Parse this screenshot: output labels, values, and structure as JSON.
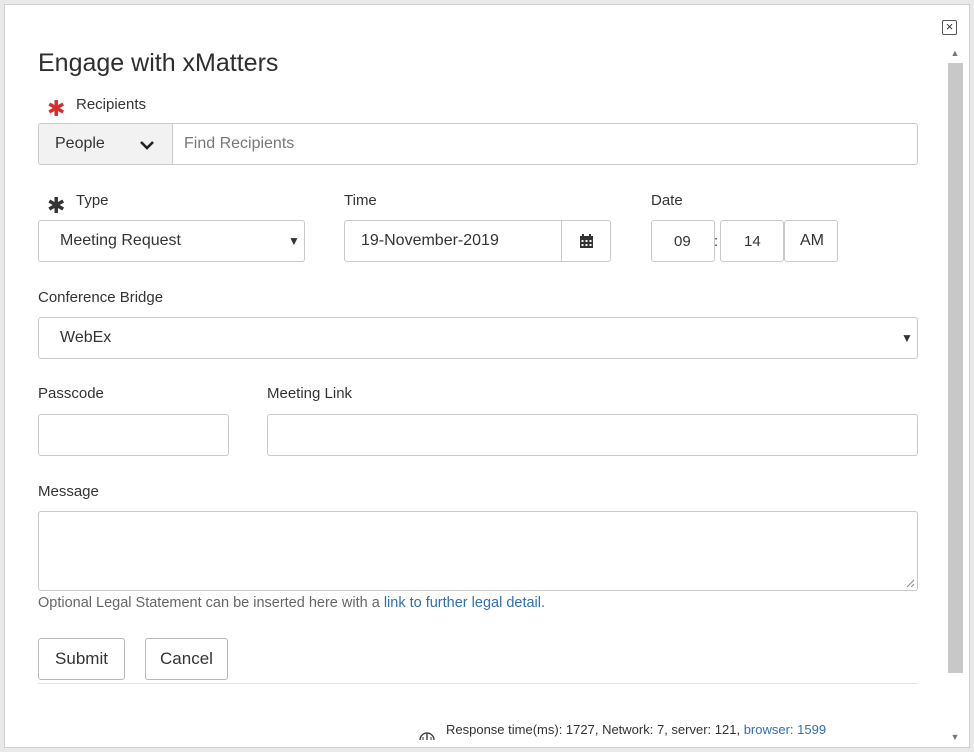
{
  "dialog": {
    "title": "Engage with xMatters",
    "close_icon": "close-icon"
  },
  "recipients": {
    "label": "Recipients",
    "type_selected": "People",
    "search_placeholder": "Find Recipients"
  },
  "type": {
    "label": "Type",
    "selected": "Meeting Request"
  },
  "time": {
    "label": "Time",
    "date_value": "19-November-2019",
    "calendar_icon": "calendar-icon"
  },
  "date": {
    "label": "Date",
    "hour": "09",
    "separator": ":",
    "minute": "14",
    "ampm": "AM"
  },
  "conference": {
    "label": "Conference Bridge",
    "selected": "WebEx"
  },
  "passcode": {
    "label": "Passcode",
    "value": ""
  },
  "meeting_link": {
    "label": "Meeting Link",
    "value": ""
  },
  "message": {
    "label": "Message",
    "value": ""
  },
  "legal": {
    "text": "Optional Legal Statement can be inserted here with a ",
    "link_text": "link to further legal detail."
  },
  "buttons": {
    "submit": "Submit",
    "cancel": "Cancel"
  },
  "footer": {
    "response_text": "Response time(ms): 1727, Network: 7, server: 121, ",
    "browser_text": "browser: 1599"
  }
}
